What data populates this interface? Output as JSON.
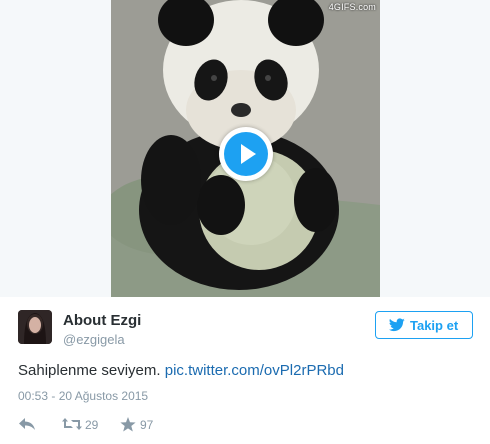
{
  "media": {
    "watermark": "4GIFS.com",
    "play_icon": "play-icon"
  },
  "tweet": {
    "display_name": "About Ezgi",
    "handle": "@ezgigela",
    "follow_label": "Takip et",
    "text": "Sahiplenme seviyem. ",
    "link": "pic.twitter.com/ovPl2rPRbd",
    "timestamp": "00:53 - 20 Ağustos 2015",
    "retweet_count": "29",
    "like_count": "97"
  },
  "colors": {
    "accent": "#1da1f2",
    "link": "#1b6bb0",
    "muted": "#8899a6",
    "text": "#292f33"
  }
}
